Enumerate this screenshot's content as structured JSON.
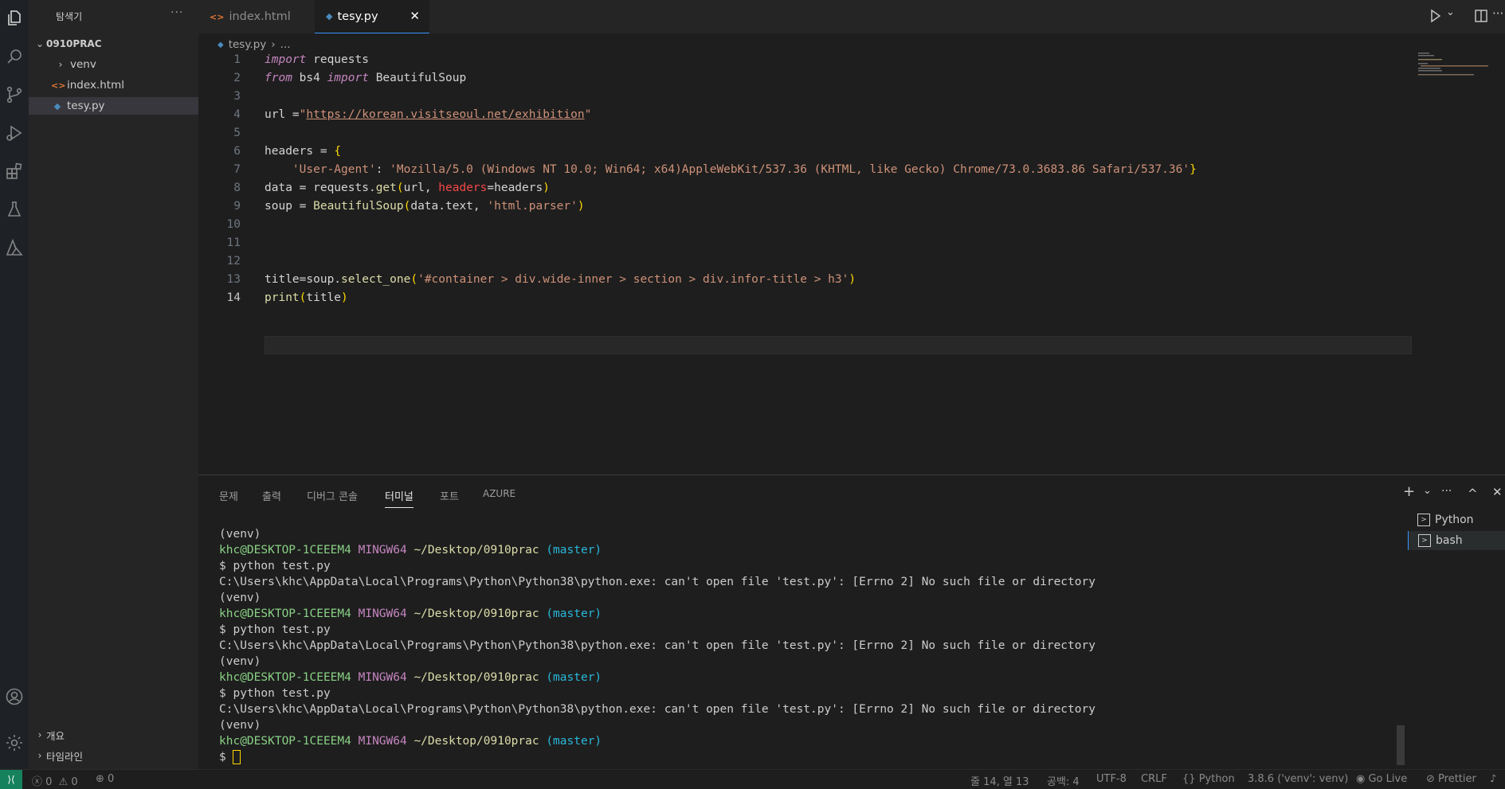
{
  "colors": {
    "accent": "#3794ff",
    "remote": "#16825d"
  },
  "activity_bar": {
    "icons": [
      "files-icon",
      "search-icon",
      "source-control-icon",
      "run-debug-icon",
      "extensions-icon",
      "testing-icon",
      "azure-icon",
      "account-icon",
      "settings-gear-icon"
    ]
  },
  "sidebar": {
    "header": "탐색기",
    "more": "···",
    "folder": "0910PRAC",
    "items": [
      {
        "label": "venv",
        "type": "folder"
      },
      {
        "label": "index.html",
        "type": "html"
      },
      {
        "label": "tesy.py",
        "type": "python"
      }
    ],
    "bottom_sections": [
      "개요",
      "타임라인"
    ]
  },
  "tabs": [
    {
      "label": "index.html",
      "icon": "html-icon"
    },
    {
      "label": "tesy.py",
      "icon": "python-icon",
      "close": "✕"
    }
  ],
  "breadcrumb": {
    "file": "tesy.py",
    "rest": "..."
  },
  "editor": {
    "line_numbers": [
      "1",
      "2",
      "3",
      "4",
      "5",
      "6",
      "7",
      "8",
      "9",
      "10",
      "11",
      "12",
      "13",
      "14"
    ],
    "current_line": 14,
    "lines": {
      "l1": {
        "kw": "import",
        "rest": " requests"
      },
      "l2": {
        "kw1": "from",
        "mid": " bs4 ",
        "kw2": "import",
        "rest": " BeautifulSoup"
      },
      "l4": {
        "a": "url =",
        "q1": "\"",
        "url": "https://korean.visitseoul.net/exhibition",
        "q2": "\""
      },
      "l6": {
        "a": "headers = ",
        "b": "{"
      },
      "l7": {
        "indent": "    ",
        "key": "'User-Agent'",
        "colon": ": ",
        "val": "'Mozilla/5.0 (Windows NT 10.0; Win64; x64)AppleWebKit/537.36 (KHTML, like Gecko) Chrome/73.0.3683.86 Safari/537.36'",
        "close": "}"
      },
      "l8": {
        "a": "data = requests.",
        "fn": "get",
        "p1": "(",
        "b": "url, ",
        "prm": "headers",
        "c": "=headers",
        "p2": ")"
      },
      "l9": {
        "a": "soup = ",
        "fn": "BeautifulSoup",
        "p1": "(",
        "b": "data.text, ",
        "str": "'html.parser'",
        "p2": ")"
      },
      "l13": {
        "a": "title",
        "eq": "=",
        "b": "soup.",
        "fn": "select_one",
        "p1": "(",
        "str": "'#container > div.wide-inner > section > div.infor-title > h3'",
        "p2": ")"
      },
      "l14": {
        "fn": "print",
        "p1": "(",
        "a": "title",
        "p2": ")"
      }
    }
  },
  "panel": {
    "tabs": [
      "문제",
      "출력",
      "디버그 콘솔",
      "터미널",
      "포트",
      "AZURE"
    ],
    "active_tab": "터미널",
    "controls": {
      "add": "+",
      "dropdown": "⌄",
      "more": "···",
      "maximize": "^",
      "close": "✕"
    },
    "terminals": [
      "Python",
      "bash"
    ],
    "terminal_lines": {
      "venv": "(venv)",
      "user": "khc@DESKTOP-1CEEEM4",
      "host": "MINGW64",
      "path": "~/Desktop/0910prac",
      "branch": "(master)",
      "cmd": "$ python test.py",
      "error": "C:\\Users\\khc\\AppData\\Local\\Programs\\Python\\Python38\\python.exe: can't open file 'test.py': [Errno 2] No such file or directory",
      "prompt": "$ "
    }
  },
  "status_bar": {
    "errors": "0",
    "warnings": "0",
    "ports": "0",
    "position": "줄 14, 열 13",
    "spaces": "공백: 4",
    "encoding": "UTF-8",
    "eol": "CRLF",
    "language": "Python",
    "interpreter": "3.8.6 ('venv': venv)",
    "go_live": "Go Live",
    "prettier": "Prettier"
  }
}
